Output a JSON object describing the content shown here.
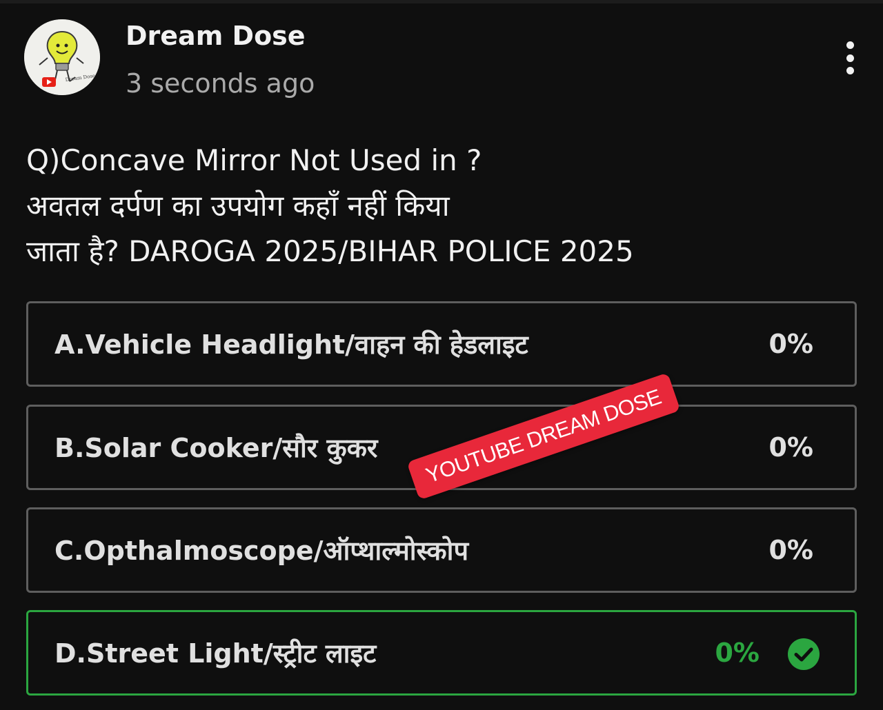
{
  "channel": {
    "name": "Dream Dose",
    "timestamp": "3 seconds ago",
    "avatar_icon": "lightbulb-avatar-icon"
  },
  "post": {
    "question_lines": [
      "Q)Concave Mirror Not Used in ?",
      "अवतल दर्पण का उपयोग कहाँ नहीं किया",
      "जाता है? DAROGA 2025/BIHAR POLICE 2025"
    ],
    "options": [
      {
        "label": "A.Vehicle Headlight/वाहन की हेडलाइट",
        "percent": "0%",
        "correct": false
      },
      {
        "label": "B.Solar Cooker/सौर कुकर",
        "percent": "0%",
        "correct": false
      },
      {
        "label": "C.Opthalmoscope/ऑप्थाल्मोस्कोप",
        "percent": "0%",
        "correct": false
      },
      {
        "label": "D.Street Light/स्ट्रीट लाइट",
        "percent": "0%",
        "correct": true
      }
    ]
  },
  "watermark": {
    "text": "YOUTUBE DREAM DOSE"
  },
  "colors": {
    "background": "#0f0f0f",
    "option_border": "#5e5e5e",
    "correct_green": "#2ba640",
    "watermark_red": "#e8283a"
  },
  "icons": {
    "menu": "more-vert-icon",
    "correct": "check-circle-icon"
  }
}
